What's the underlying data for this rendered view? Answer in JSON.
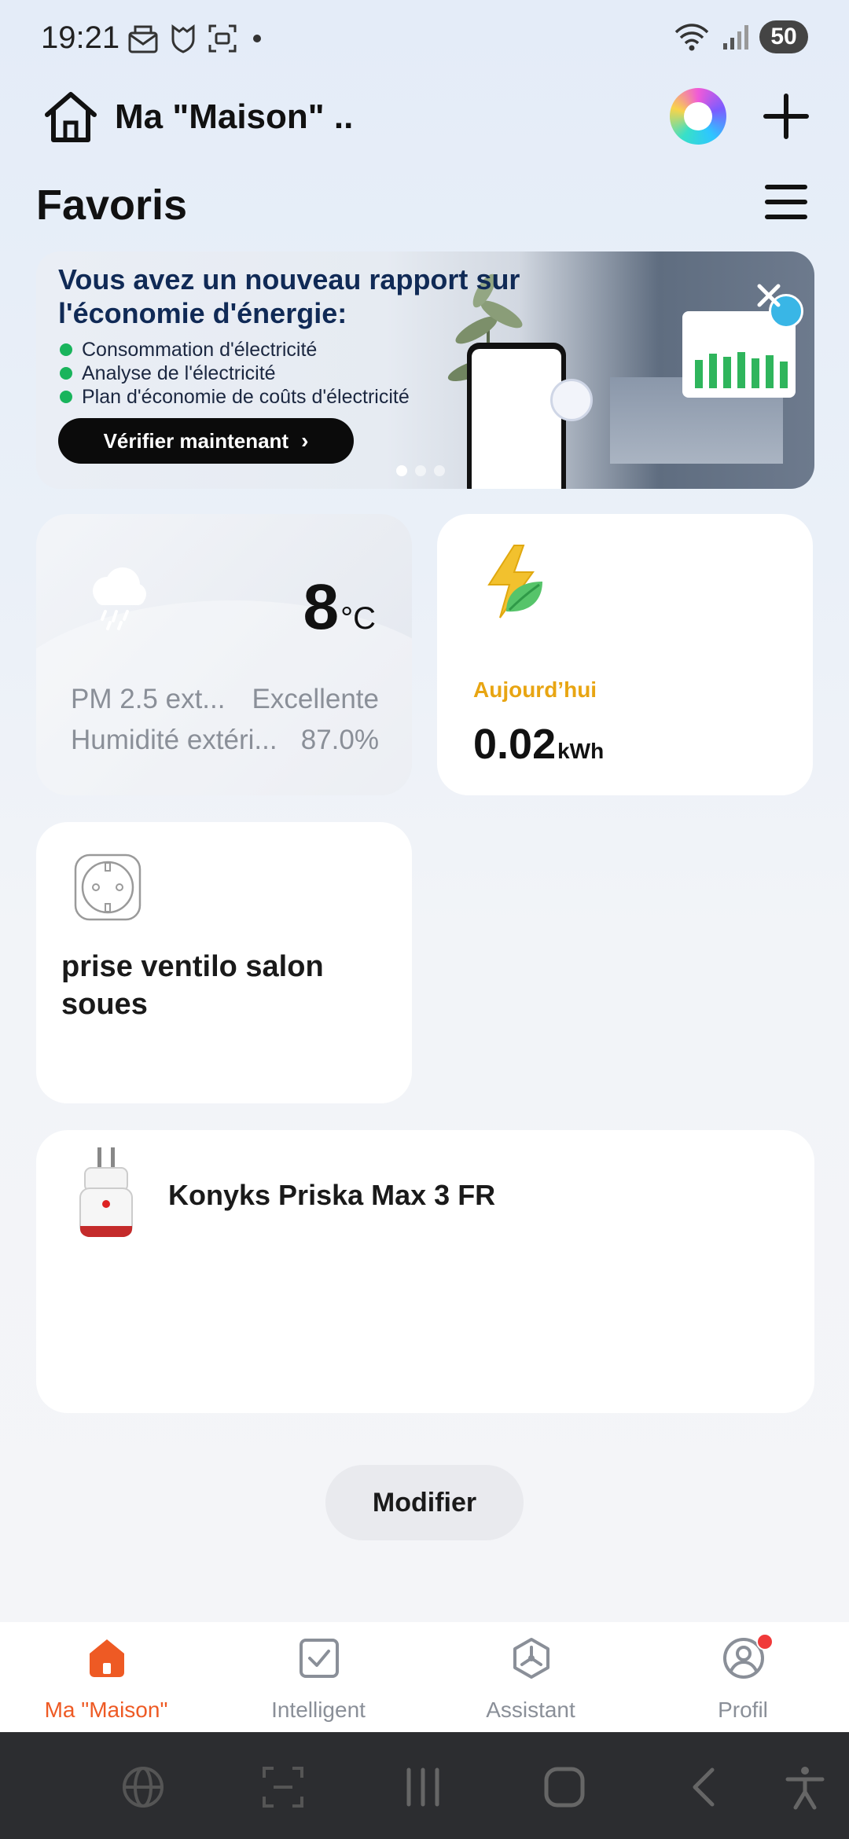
{
  "status_bar": {
    "time": "19:21",
    "battery": "50",
    "icons": [
      "mail-icon",
      "shield-icon",
      "screenshot-icon",
      "notification-dot",
      "wifi-icon",
      "signal-icon",
      "battery-icon"
    ]
  },
  "header": {
    "title": "Ma \"Maison\" ..",
    "icons": [
      "home-icon",
      "ai-assistant-icon",
      "add-icon"
    ]
  },
  "favorites": {
    "title": "Favoris",
    "menu_icon": "list-icon"
  },
  "banner": {
    "title": "Vous avez un nouveau rapport sur l'économie d'énergie:",
    "bullets": [
      "Consommation d'électricité",
      "Analyse de l'électricité",
      "Plan d'économie de coûts d'électricité"
    ],
    "cta": "Vérifier maintenant",
    "page_count": 3,
    "active_page": 1
  },
  "weather": {
    "temperature": "8",
    "unit": "°C",
    "icon": "rain-cloud-icon",
    "rows": [
      {
        "label": "PM 2.5 ext...",
        "value": "Excellente"
      },
      {
        "label": "Humidité extéri...",
        "value": "87.0%"
      }
    ]
  },
  "energy": {
    "label": "Aujourd’hui",
    "value": "0.02",
    "unit": "kWh",
    "icon": "energy-leaf-icon"
  },
  "plug_card": {
    "name": "prise ventilo salon soues",
    "icon": "socket-icon"
  },
  "device_card": {
    "name": "Konyks Priska Max 3 FR",
    "icon": "smart-plug-icon"
  },
  "edit_button": "Modifier",
  "bottom_nav": [
    {
      "label": "Ma \"Maison\"",
      "icon": "home-icon",
      "active": true
    },
    {
      "label": "Intelligent",
      "icon": "checkbox-icon",
      "active": false
    },
    {
      "label": "Assistant",
      "icon": "assistant-icon",
      "active": false
    },
    {
      "label": "Profil",
      "icon": "profile-icon",
      "active": false,
      "badge": true
    }
  ],
  "colors": {
    "accent": "#ee5a24",
    "energy_label": "#e8a512",
    "banner_title": "#102a56",
    "notification": "#f03a3a"
  }
}
